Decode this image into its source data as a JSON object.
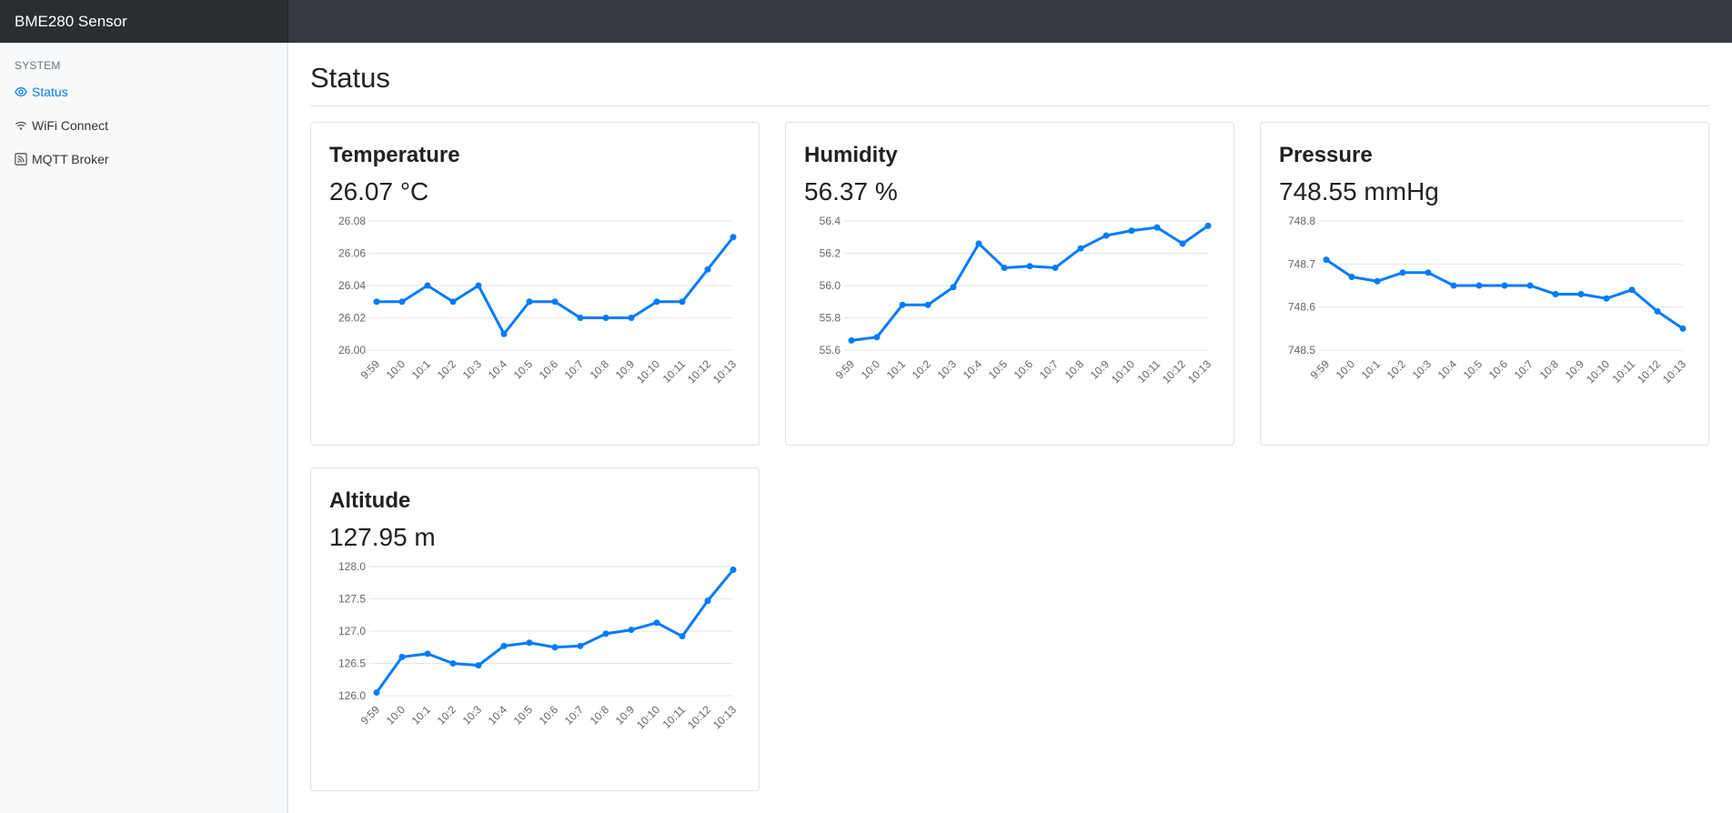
{
  "app": {
    "title": "BME280 Sensor"
  },
  "sidebar": {
    "heading": "SYSTEM",
    "items": [
      {
        "label": "Status",
        "icon": "eye-icon",
        "active": true
      },
      {
        "label": "WiFi Connect",
        "icon": "wifi-icon",
        "active": false
      },
      {
        "label": "MQTT Broker",
        "icon": "rss-icon",
        "active": false
      }
    ]
  },
  "page": {
    "title": "Status"
  },
  "colors": {
    "accent": "#007bff",
    "topbar": "#343a40"
  },
  "cards": [
    {
      "title": "Temperature",
      "value": "26.07 °C"
    },
    {
      "title": "Humidity",
      "value": "56.37 %"
    },
    {
      "title": "Pressure",
      "value": "748.55 mmHg"
    },
    {
      "title": "Altitude",
      "value": "127.95 m"
    }
  ],
  "chart_data": [
    {
      "type": "line",
      "x": [
        "9:59",
        "10:0",
        "10:1",
        "10:2",
        "10:3",
        "10:4",
        "10:5",
        "10:6",
        "10:7",
        "10:8",
        "10:9",
        "10:10",
        "10:11",
        "10:12",
        "10:13"
      ],
      "values": [
        26.03,
        26.03,
        26.04,
        26.03,
        26.04,
        26.01,
        26.03,
        26.03,
        26.02,
        26.02,
        26.02,
        26.03,
        26.03,
        26.05,
        26.07
      ],
      "ylim": [
        26.0,
        26.08
      ],
      "yticks": [
        "26.08",
        "26.06",
        "26.04",
        "26.02",
        "26.00"
      ],
      "grid": true,
      "color": "#007bff"
    },
    {
      "type": "line",
      "x": [
        "9:59",
        "10:0",
        "10:1",
        "10:2",
        "10:3",
        "10:4",
        "10:5",
        "10:6",
        "10:7",
        "10:8",
        "10:9",
        "10:10",
        "10:11",
        "10:12",
        "10:13"
      ],
      "values": [
        55.66,
        55.68,
        55.88,
        55.88,
        55.99,
        56.26,
        56.11,
        56.12,
        56.11,
        56.23,
        56.31,
        56.34,
        56.36,
        56.26,
        56.37
      ],
      "ylim": [
        55.6,
        56.4
      ],
      "yticks": [
        "56.4",
        "56.2",
        "56.0",
        "55.8",
        "55.6"
      ],
      "grid": true,
      "color": "#007bff"
    },
    {
      "type": "line",
      "x": [
        "9:59",
        "10:0",
        "10:1",
        "10:2",
        "10:3",
        "10:4",
        "10:5",
        "10:6",
        "10:7",
        "10:8",
        "10:9",
        "10:10",
        "10:11",
        "10:12",
        "10:13"
      ],
      "values": [
        748.71,
        748.67,
        748.66,
        748.68,
        748.68,
        748.65,
        748.65,
        748.65,
        748.65,
        748.63,
        748.63,
        748.62,
        748.64,
        748.59,
        748.55
      ],
      "ylim": [
        748.5,
        748.8
      ],
      "yticks": [
        "748.8",
        "748.7",
        "748.6",
        "748.5"
      ],
      "grid": true,
      "color": "#007bff"
    },
    {
      "type": "line",
      "x": [
        "9:59",
        "10:0",
        "10:1",
        "10:2",
        "10:3",
        "10:4",
        "10:5",
        "10:6",
        "10:7",
        "10:8",
        "10:9",
        "10:10",
        "10:11",
        "10:12",
        "10:13"
      ],
      "values": [
        126.05,
        126.6,
        126.65,
        126.5,
        126.47,
        126.77,
        126.82,
        126.75,
        126.77,
        126.96,
        127.02,
        127.13,
        126.92,
        127.47,
        127.95
      ],
      "ylim": [
        126.0,
        128.0
      ],
      "yticks": [
        "128.0",
        "127.5",
        "127.0",
        "126.5",
        "126.0"
      ],
      "grid": true,
      "color": "#007bff"
    }
  ]
}
